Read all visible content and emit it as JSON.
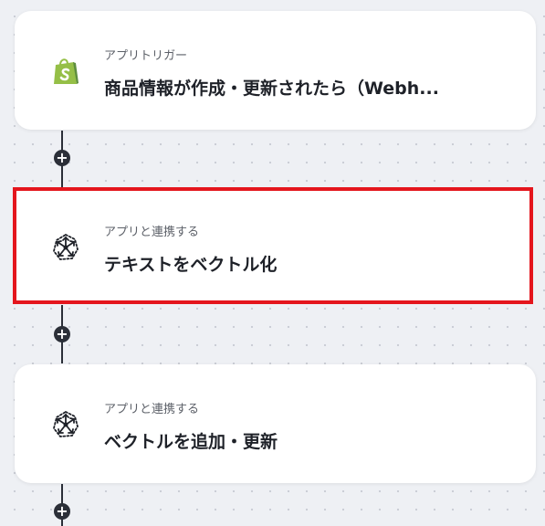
{
  "flow": {
    "steps": [
      {
        "subtitle": "アプリトリガー",
        "title": "商品情報が作成・更新されたら（Webh...",
        "icon": "shopify-icon",
        "highlighted": false
      },
      {
        "subtitle": "アプリと連携する",
        "title": "テキストをベクトル化",
        "icon": "ai-network-icon",
        "highlighted": true
      },
      {
        "subtitle": "アプリと連携する",
        "title": "ベクトルを追加・更新",
        "icon": "ai-network-icon",
        "highlighted": false
      }
    ],
    "add_label": "+"
  },
  "colors": {
    "highlight": "#e4161d",
    "shopify_green": "#95bf47",
    "connector": "#2b2f38"
  }
}
